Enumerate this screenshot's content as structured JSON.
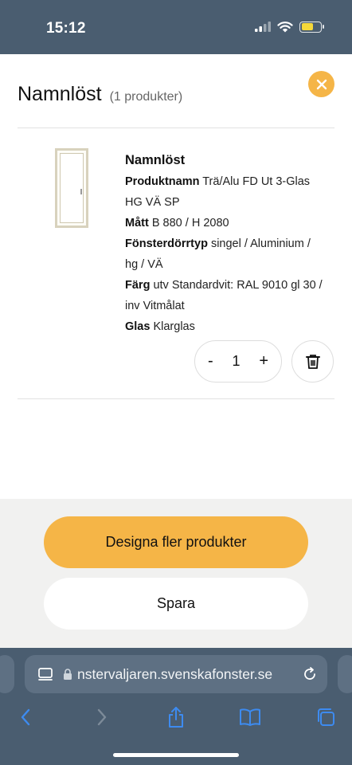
{
  "status_bar": {
    "time": "15:12",
    "battery_color": "#f5d83a"
  },
  "modal": {
    "title": "Namnlöst",
    "count": "(1 produkter)",
    "accent_color": "#f5b547",
    "close_icon": "close-icon"
  },
  "product": {
    "name": "Namnlöst",
    "rows": [
      {
        "label": "Produktnamn",
        "value": "Trä/Alu FD Ut 3-Glas HG VÄ SP"
      },
      {
        "label": "Mått",
        "value": "B 880 / H 2080"
      },
      {
        "label": "Fönsterdörrtyp",
        "value": "singel / Aluminium / hg / VÄ"
      },
      {
        "label": "Färg",
        "value": "utv Standardvit: RAL 9010 gl 30 / inv Vitmålat"
      },
      {
        "label": "Glas",
        "value": "Klarglas"
      }
    ],
    "quantity": "1",
    "decrement_label": "-",
    "increment_label": "+"
  },
  "footer": {
    "primary_label": "Designa fler produkter",
    "secondary_label": "Spara"
  },
  "browser": {
    "url": "nstervaljaren.svenskafonster.se"
  }
}
